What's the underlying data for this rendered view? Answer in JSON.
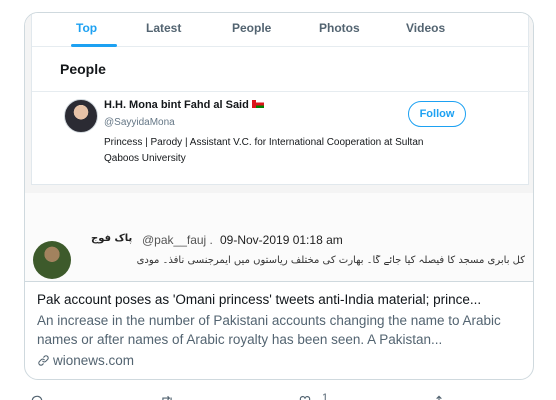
{
  "search_tabs": [
    {
      "label": "Top",
      "active": true
    },
    {
      "label": "Latest",
      "active": false
    },
    {
      "label": "People",
      "active": false
    },
    {
      "label": "Photos",
      "active": false
    },
    {
      "label": "Videos",
      "active": false
    }
  ],
  "people_section": {
    "heading": "People",
    "user": {
      "display_name": "H.H. Mona bint Fahd al Said",
      "handle": "@SayyidaMona",
      "bio": "Princess | Parody | Assistant V.C. for International Cooperation at Sultan Qaboos University",
      "follow_label": "Follow"
    }
  },
  "tweet": {
    "urdu_name": "پاک فوج",
    "handle": "@pak__fauj .",
    "date": "09-Nov-2019 01:18 am",
    "text": "کل بابری مسجد کا فیصلہ کیا جائے گا۔ بھارت کی مختلف ریاستوں میں ایمرجنسی نافذ۔ مودی"
  },
  "card": {
    "title": "Pak account poses as 'Omani princess' tweets anti-India material; prince...",
    "description": "An increase in the number of Pakistani accounts changing the name to Arabic names or after names of Arabic royalty has been seen. A Pakistan...",
    "domain": "wionews.com",
    "domain_icon": "link-icon"
  },
  "actions": {
    "like_count": "1"
  },
  "colors": {
    "accent": "#1da1f2",
    "secondary_text": "#536471",
    "border": "#cfd9de"
  }
}
